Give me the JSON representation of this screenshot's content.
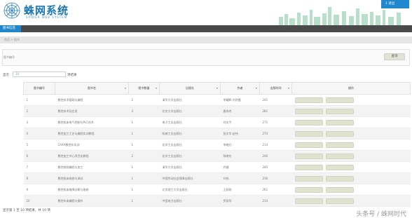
{
  "header": {
    "title": "蛛网系统",
    "subtitle": "SPIDER WEB SYSTEM",
    "user_button": "1 退出"
  },
  "nav": {
    "active_tab": "图书信息"
  },
  "breadcrumb": "首页 > 图书",
  "filter": {
    "label": "图书编号",
    "query_button": "查询"
  },
  "page_size": {
    "prefix": "显示",
    "value": "10",
    "suffix": "项结果"
  },
  "table": {
    "columns": [
      "图书编号",
      "图书名",
      "图书数量",
      "出版社",
      "作者",
      "出版时间",
      "操作"
    ],
    "rows": [
      {
        "id": "1",
        "name": "数控技术基础与编程",
        "qty": "2",
        "publisher": "清华大学出版社",
        "author": "李耀辉 刘洪霞",
        "date": "241"
      },
      {
        "id": "2",
        "name": "数控技术及应用",
        "qty": "3",
        "publisher": "北京大学出版社",
        "author": "唐伟杰",
        "date": "281"
      },
      {
        "id": "3",
        "name": "数控机床电气控制与PLC技术",
        "qty": "1",
        "publisher": "电子工业出版社",
        "author": "刘文平",
        "date": "271"
      },
      {
        "id": "4",
        "name": "数控加工工艺与编程实训教程",
        "qty": "1",
        "publisher": "机械工业出版社",
        "author": "张文华 赵伟",
        "date": "274"
      },
      {
        "id": "5",
        "name": "CAXA数控车实训",
        "qty": "1",
        "publisher": "化学工业出版社",
        "author": "李晓红",
        "date": "214"
      },
      {
        "id": "6",
        "name": "数控加工中心项目化教程",
        "qty": "2",
        "publisher": "化学工业出版社",
        "author": "陈晓东",
        "date": "240"
      },
      {
        "id": "7",
        "name": "数控铣削编程与加工",
        "qty": "1",
        "publisher": "清华大学出版社",
        "author": "齐健",
        "date": "285"
      },
      {
        "id": "8",
        "name": "数控机床维修与调试",
        "qty": "1",
        "publisher": "中国劳动社会保障出版社",
        "author": "刘伟",
        "date": "236"
      },
      {
        "id": "9",
        "name": "数控机床故障诊断与维修",
        "qty": "1",
        "publisher": "北京理工大学出版社",
        "author": "王跃刚",
        "date": "261"
      },
      {
        "id": "10",
        "name": "数控车床编程与操作",
        "qty": "1",
        "publisher": "中国电力出版社",
        "author": "罗双华",
        "date": "214"
      }
    ]
  },
  "footer": {
    "summary": "显示第 1 至 10 项结果，共 10 项",
    "watermark": "头条号 / 蛛网时代"
  },
  "colors": {
    "brand": "#1b76b2",
    "nav_dark": "#4a4a4a",
    "accent": "#2086cb"
  }
}
